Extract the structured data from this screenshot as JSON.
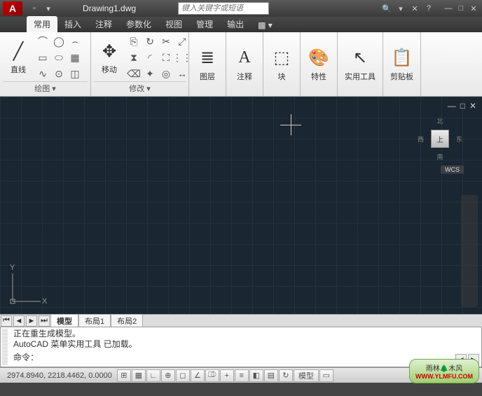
{
  "title": "Drawing1.dwg",
  "app_letter": "A",
  "search_placeholder": "键入关键字或短语",
  "tabs": {
    "t0": "常用",
    "t1": "插入",
    "t2": "注释",
    "t3": "参数化",
    "t4": "视图",
    "t5": "管理",
    "t6": "输出"
  },
  "panels": {
    "draw": {
      "title": "绘图 ▾",
      "big": "直线"
    },
    "modify": {
      "title": "修改 ▾",
      "big": "移动"
    },
    "layer": {
      "title": "图层"
    },
    "annot": {
      "title": "注释"
    },
    "block": {
      "title": "块"
    },
    "props": {
      "title": "特性"
    },
    "util": {
      "title": "实用工具"
    },
    "clip": {
      "title": "剪贴板"
    }
  },
  "viewcube": {
    "center": "上",
    "n": "北",
    "s": "南",
    "e": "东",
    "w": "西"
  },
  "wcs": "WCS",
  "ucs": {
    "x": "X",
    "y": "Y"
  },
  "layout": {
    "model": "模型",
    "l1": "布局1",
    "l2": "布局2"
  },
  "cmd": {
    "l1": "正在重生成模型。",
    "l2": "AutoCAD 菜单实用工具 已加载。",
    "l3": "命令：",
    "scroll_left": "◄",
    "scroll_right": "►"
  },
  "coords": "2974.8940, 2218.4462, 0.0000",
  "status_model": "模型",
  "watermark": {
    "name": "雨林🌲木风",
    "url": "WWW.YLMFU.COM"
  }
}
